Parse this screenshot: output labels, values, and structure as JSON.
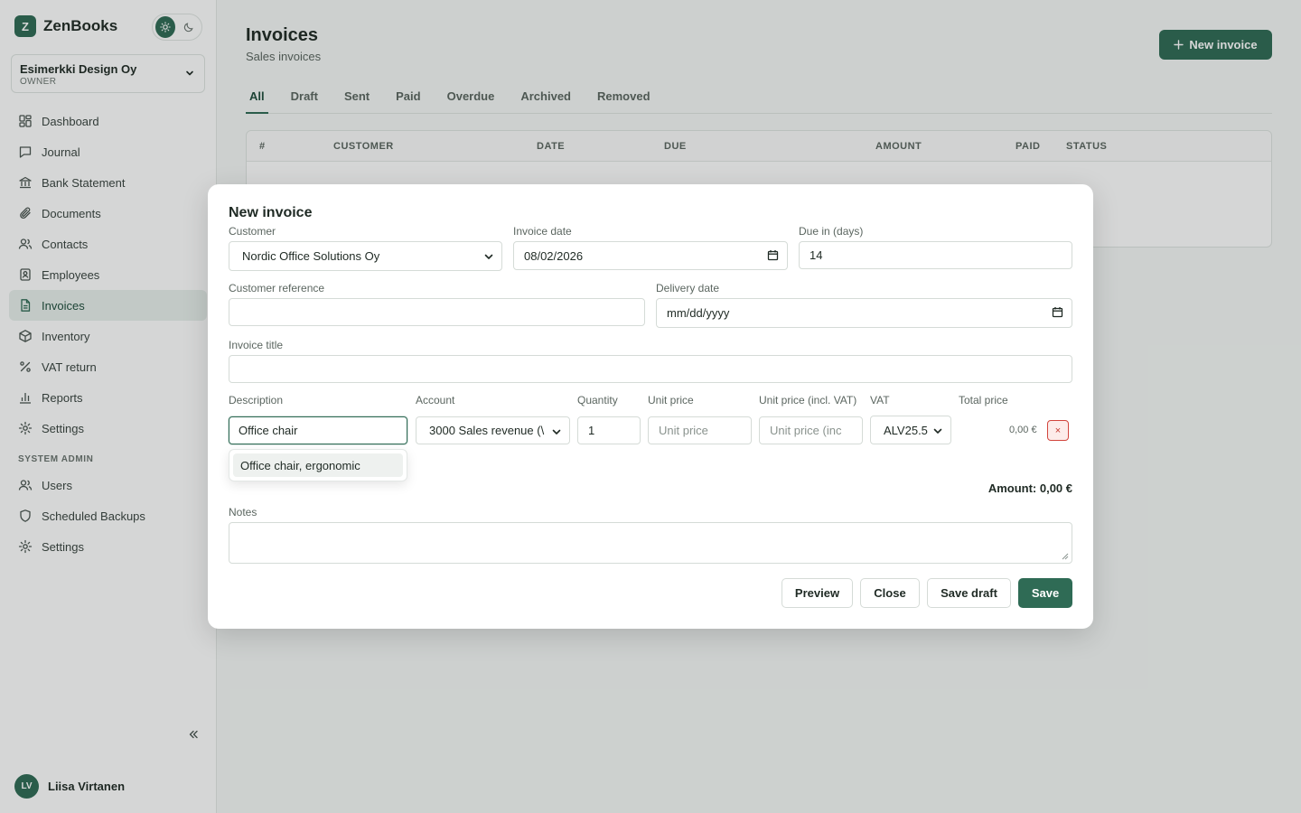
{
  "app": {
    "logo_letter": "Z",
    "name": "ZenBooks"
  },
  "company": {
    "name": "Esimerkki Design Oy",
    "role": "OWNER"
  },
  "nav": {
    "items": [
      {
        "label": "Dashboard",
        "icon": "dashboard-icon"
      },
      {
        "label": "Journal",
        "icon": "journal-icon"
      },
      {
        "label": "Bank Statement",
        "icon": "bank-icon"
      },
      {
        "label": "Documents",
        "icon": "paperclip-icon"
      },
      {
        "label": "Contacts",
        "icon": "contacts-icon"
      },
      {
        "label": "Employees",
        "icon": "employee-badge-icon"
      },
      {
        "label": "Invoices",
        "icon": "invoice-icon",
        "active": true
      },
      {
        "label": "Inventory",
        "icon": "box-icon"
      },
      {
        "label": "VAT return",
        "icon": "percent-icon"
      },
      {
        "label": "Reports",
        "icon": "bar-chart-icon"
      },
      {
        "label": "Settings",
        "icon": "gear-icon"
      }
    ],
    "section_label": "SYSTEM ADMIN",
    "admin_items": [
      {
        "label": "Users",
        "icon": "users-icon"
      },
      {
        "label": "Scheduled Backups",
        "icon": "shield-icon"
      },
      {
        "label": "Settings",
        "icon": "gear-icon"
      }
    ]
  },
  "user": {
    "initials": "LV",
    "name": "Liisa Virtanen"
  },
  "page": {
    "title": "Invoices",
    "subtitle": "Sales invoices",
    "new_button": "New invoice",
    "tabs": [
      "All",
      "Draft",
      "Sent",
      "Paid",
      "Overdue",
      "Archived",
      "Removed"
    ],
    "active_tab": "All",
    "table_headers": [
      "#",
      "CUSTOMER",
      "DATE",
      "DUE",
      "AMOUNT",
      "PAID",
      "STATUS"
    ]
  },
  "modal": {
    "title": "New invoice",
    "customer": {
      "label": "Customer",
      "value": "Nordic Office Solutions Oy"
    },
    "invoice_date": {
      "label": "Invoice date",
      "value": "08/02/2026"
    },
    "due_days": {
      "label": "Due in (days)",
      "value": "14"
    },
    "customer_reference": {
      "label": "Customer reference",
      "value": ""
    },
    "delivery_date": {
      "label": "Delivery date",
      "value": "mm/dd/yyyy"
    },
    "invoice_title": {
      "label": "Invoice title",
      "value": ""
    },
    "line_headers": {
      "description": "Description",
      "account": "Account",
      "quantity": "Quantity",
      "unit_price": "Unit price",
      "unit_price_vat": "Unit price (incl. VAT)",
      "vat": "VAT",
      "total": "Total price"
    },
    "line": {
      "description": "Office chair",
      "account": "3000 Sales revenue (\\",
      "quantity": "1",
      "unit_price_placeholder": "Unit price",
      "unit_price_vat_placeholder": "Unit price (inc",
      "vat": "ALV25.5",
      "total": "0,00 €",
      "delete": "×"
    },
    "suggestion": "Office chair, ergonomic",
    "amount": "Amount: 0,00 €",
    "notes_label": "Notes",
    "notes_value": "",
    "buttons": {
      "preview": "Preview",
      "close": "Close",
      "save_draft": "Save draft",
      "save": "Save"
    }
  },
  "colors": {
    "accent": "#2f6b55",
    "danger": "#d2453d"
  }
}
